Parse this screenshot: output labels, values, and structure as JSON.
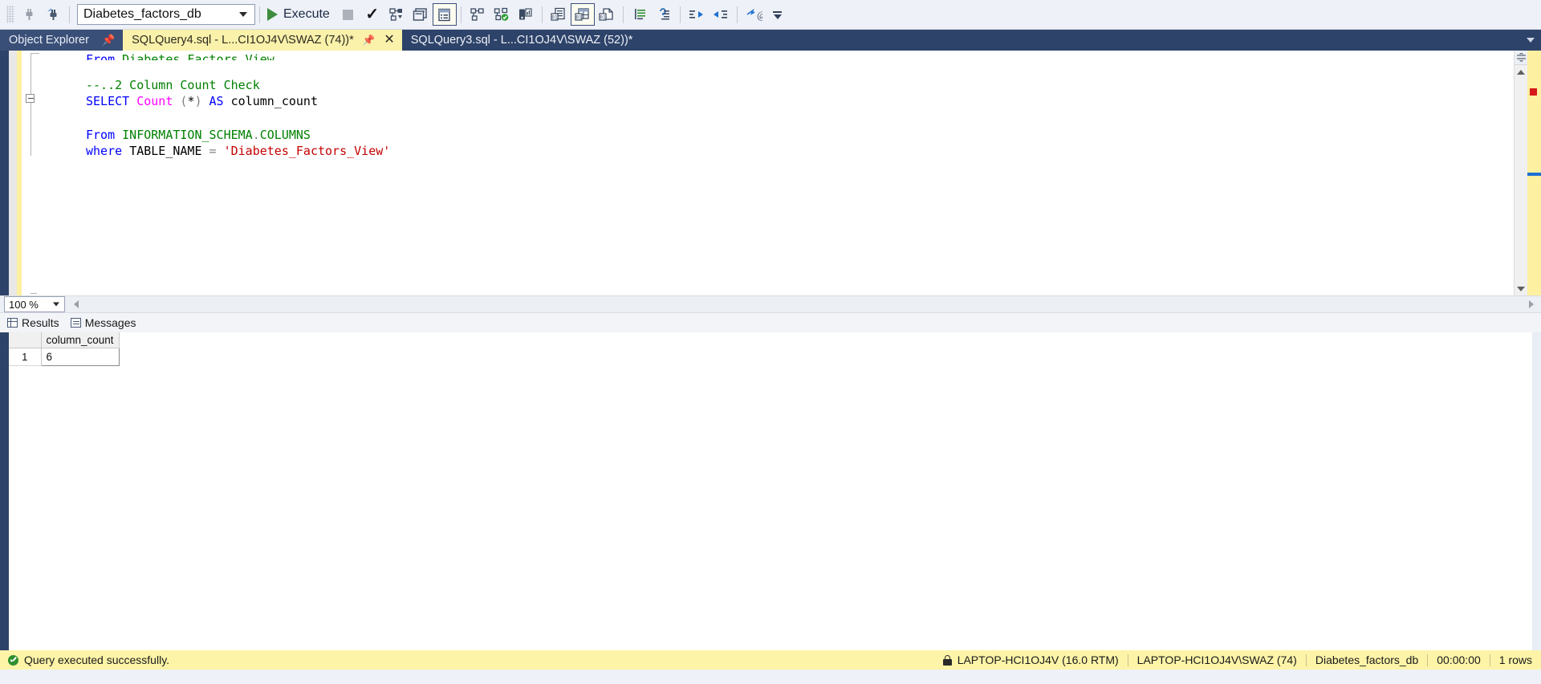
{
  "toolbar": {
    "database_value": "Diabetes_factors_db",
    "execute_label": "Execute",
    "icons": [
      {
        "name": "grip-handle",
        "label": ""
      },
      {
        "name": "connect-icon",
        "label": ""
      },
      {
        "name": "connect-object-explorer-icon",
        "label": ""
      },
      {
        "name": "execute-icon",
        "label": "Execute"
      },
      {
        "name": "stop-icon",
        "label": ""
      },
      {
        "name": "parse-check-icon",
        "label": ""
      },
      {
        "name": "display-estimated-execution-plan-icon",
        "label": ""
      },
      {
        "name": "query-options-icon",
        "label": ""
      },
      {
        "name": "intellisense-enabled-icon",
        "label": ""
      },
      {
        "name": "include-actual-execution-plan-icon",
        "label": ""
      },
      {
        "name": "include-live-query-statistics-icon",
        "label": ""
      },
      {
        "name": "include-client-statistics-icon",
        "label": ""
      },
      {
        "name": "results-to-text-icon",
        "label": ""
      },
      {
        "name": "results-to-grid-icon",
        "label": ""
      },
      {
        "name": "results-to-file-icon",
        "label": ""
      },
      {
        "name": "comment-lines-icon",
        "label": ""
      },
      {
        "name": "uncomment-lines-icon",
        "label": ""
      },
      {
        "name": "decrease-indent-icon",
        "label": ""
      },
      {
        "name": "increase-indent-icon",
        "label": ""
      },
      {
        "name": "specify-values-for-template-parameters-icon",
        "label": ""
      },
      {
        "name": "toolbar-overflow-icon",
        "label": ""
      }
    ]
  },
  "tabs": {
    "object_explorer_label": "Object Explorer",
    "documents": [
      {
        "label": "SQLQuery4.sql - L...CI1OJ4V\\SWAZ (74))*",
        "active": true
      },
      {
        "label": "SQLQuery3.sql - L...CI1OJ4V\\SWAZ (52))*",
        "active": false
      }
    ]
  },
  "editor": {
    "lines": [
      {
        "tokens": [
          {
            "t": "From Diabetes_Factors_View",
            "c": "clipped"
          }
        ]
      },
      {
        "tokens": []
      },
      {
        "tokens": [
          {
            "t": "--..2 Column Count Check",
            "c": "cmt"
          }
        ]
      },
      {
        "tokens": [
          {
            "t": "SELECT ",
            "c": "kw"
          },
          {
            "t": "Count ",
            "c": "fn"
          },
          {
            "t": "(",
            "c": "gry"
          },
          {
            "t": "*",
            "c": "pl"
          },
          {
            "t": ") ",
            "c": "gry"
          },
          {
            "t": "AS ",
            "c": "kw"
          },
          {
            "t": "column_count",
            "c": "pl"
          }
        ]
      },
      {
        "tokens": []
      },
      {
        "tokens": [
          {
            "t": "From ",
            "c": "kw"
          },
          {
            "t": "INFORMATION_SCHEMA",
            "c": "grn"
          },
          {
            "t": ".",
            "c": "gry"
          },
          {
            "t": "COLUMNS",
            "c": "grn"
          }
        ]
      },
      {
        "tokens": [
          {
            "t": "where ",
            "c": "kw"
          },
          {
            "t": "TABLE_NAME ",
            "c": "pl"
          },
          {
            "t": "= ",
            "c": "gry"
          },
          {
            "t": "'Diabetes_Factors_View'",
            "c": "str"
          }
        ]
      }
    ]
  },
  "zoombar": {
    "zoom_value": "100 %"
  },
  "results": {
    "tabs": [
      {
        "label": "Results",
        "icon": "grid-icon",
        "active": true
      },
      {
        "label": "Messages",
        "icon": "messages-icon",
        "active": false
      }
    ],
    "columns": [
      "column_count"
    ],
    "rows": [
      {
        "num": "1",
        "values": [
          "6"
        ]
      }
    ]
  },
  "statusbar": {
    "message": "Query executed successfully.",
    "server": "LAPTOP-HCI1OJ4V (16.0 RTM)",
    "user": "LAPTOP-HCI1OJ4V\\SWAZ (74)",
    "database": "Diabetes_factors_db",
    "elapsed": "00:00:00",
    "rows": "1 rows"
  },
  "colors": {
    "accent_navy": "#2e4369",
    "active_tab_yellow": "#faf1ab",
    "statusbar_yellow": "#fdf4a8",
    "keyword_blue": "#0000ff",
    "function_magenta": "#ff00ff",
    "comment_green": "#008000",
    "string_red": "#c40000"
  }
}
